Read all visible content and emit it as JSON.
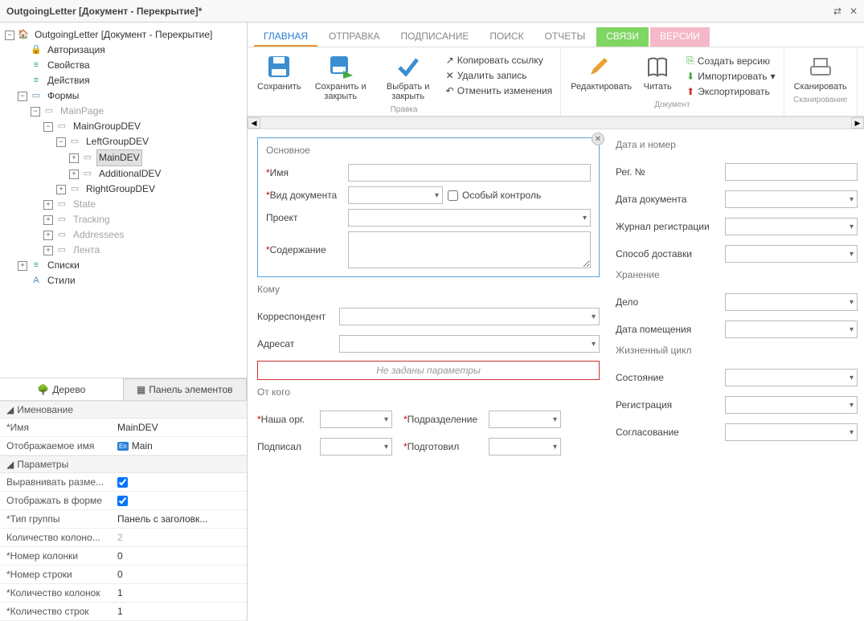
{
  "window": {
    "title": "OutgoingLetter [Документ - Перекрытие]*"
  },
  "tree": {
    "root": "OutgoingLetter [Документ - Перекрытие]",
    "auth": "Авторизация",
    "props": "Свойства",
    "actions": "Действия",
    "forms": "Формы",
    "mainpage": "MainPage",
    "maingroup": "MainGroupDEV",
    "leftgroup": "LeftGroupDEV",
    "maindev": "MainDEV",
    "additionaldev": "AdditionalDEV",
    "rightgroup": "RightGroupDEV",
    "state": "State",
    "tracking": "Tracking",
    "addressees": "Addressees",
    "lenta": "Лента",
    "lists": "Списки",
    "styles": "Стили"
  },
  "leftTabs": {
    "tree": "Дерево",
    "panel": "Панель элементов"
  },
  "propSections": {
    "naming": "Именование",
    "params": "Параметры"
  },
  "propRows": {
    "name_k": "*Имя",
    "name_v": "MainDEV",
    "disp_k": "Отображаемое имя",
    "disp_v": "Main",
    "align_k": "Выравнивать разме...",
    "showform_k": "Отображать в форме",
    "grouptype_k": "*Тип группы",
    "grouptype_v": "Панель с заголовк...",
    "colcount0_k": "Количество колоно...",
    "colcount0_v": "2",
    "colnum_k": "*Номер колонки",
    "colnum_v": "0",
    "rownum_k": "*Номер строки",
    "rownum_v": "0",
    "colcount_k": "*Количество колонок",
    "colcount_v": "1",
    "rowcount_k": "*Количество строк",
    "rowcount_v": "1"
  },
  "tabs": {
    "main": "ГЛАВНАЯ",
    "send": "ОТПРАВКА",
    "sign": "ПОДПИСАНИЕ",
    "search": "ПОИСК",
    "reports": "ОТЧЕТЫ",
    "links": "СВЯЗИ",
    "versions": "ВЕРСИИ"
  },
  "ribbon": {
    "save": "Сохранить",
    "saveclose": "Сохранить и закрыть",
    "selectclose": "Выбрать и закрыть",
    "copylink": "Копировать ссылку",
    "delete": "Удалить запись",
    "undo": "Отменить изменения",
    "edit": "Редактировать",
    "read": "Читать",
    "createver": "Создать версию",
    "import": "Импортировать",
    "export": "Экспортировать",
    "scan": "Сканировать",
    "g_edit": "Правка",
    "g_doc": "Документ",
    "g_scan": "Сканирование"
  },
  "form": {
    "grp_main": "Основное",
    "name": "Имя",
    "doctype": "Вид документа",
    "special": "Особый контроль",
    "project": "Проект",
    "content": "Содержание",
    "grp_whom": "Кому",
    "corr": "Корреспондент",
    "addressee": "Адресат",
    "noset": "Не заданы параметры",
    "grp_from": "От кого",
    "ourorg": "Наша орг.",
    "dept": "Подразделение",
    "signed": "Подписал",
    "prepared": "Подготовил",
    "grp_date": "Дата и номер",
    "regno": "Рег. №",
    "docdate": "Дата документа",
    "journal": "Журнал регистрации",
    "delivery": "Способ доставки",
    "grp_storage": "Хранение",
    "case": "Дело",
    "placed": "Дата помещения",
    "grp_life": "Жизненный цикл",
    "status": "Состояние",
    "reg": "Регистрация",
    "agree": "Согласование"
  }
}
